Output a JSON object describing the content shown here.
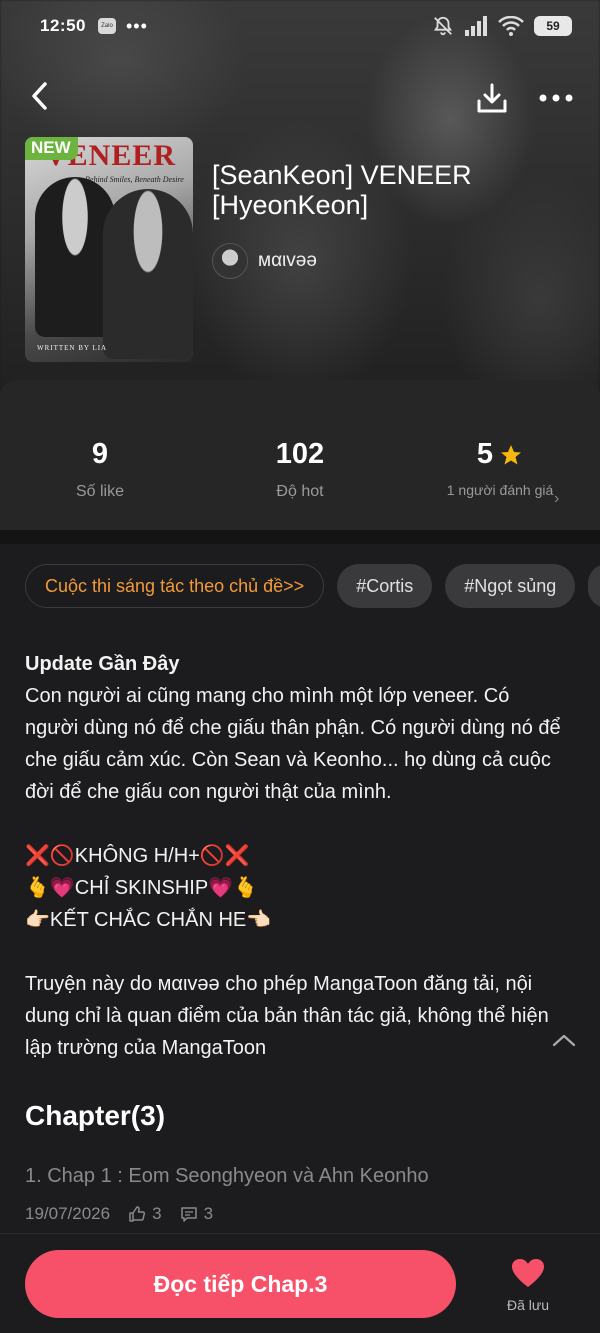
{
  "status_bar": {
    "time": "12:50",
    "zalo_label": "Zalo",
    "dots": "•••",
    "battery": "59"
  },
  "story": {
    "title": "[SeanKeon] VENEER [HyeonKeon]",
    "new_badge": "NEW",
    "cover_title": "VENEER",
    "cover_subtitle": "Behind Smiles, Beneath Desire",
    "cover_credit": "WRITTEN BY LIA",
    "author": "мαιvәә"
  },
  "stats": {
    "likes_value": "9",
    "likes_label": "Số like",
    "hot_value": "102",
    "hot_label": "Độ hot",
    "rating_value": "5",
    "rating_label": "1 người đánh giá"
  },
  "tags": [
    "Cuộc thi sáng tác theo chủ đề>>",
    "#Cortis",
    "#Ngọt sủng"
  ],
  "description": {
    "heading": "Update Gần Đây",
    "body": "Con người ai cũng mang cho mình một lớp veneer. Có người dùng nó để che giấu thân phận. Có người dùng nó để che giấu cảm xúc. Còn Sean và Keonho... họ dùng cả cuộc đời để che giấu con người thật của mình.",
    "line1": "❌🚫KHÔNG H/H+🚫❌",
    "line2": "🫰💗CHỈ SKINSHIP💗🫰",
    "line3": "👉🏻KẾT CHẮC CHẮN HE👈🏻",
    "disclaimer": "Truyện này do мαιvәә cho phép MangaToon đăng tải, nội dung chỉ là quan điểm của bản thân tác giả, không thể hiện lập trường của MangaToon"
  },
  "chapters": {
    "header": "Chapter(3)",
    "items": [
      {
        "title": "1. Chap 1 : Eom Seonghyeon và Ahn Keonho",
        "date": "19/07/2026",
        "likes": "3",
        "comments": "3"
      }
    ]
  },
  "bottom": {
    "read_label": "Đọc tiếp Chap.3",
    "saved_label": "Đã lưu"
  },
  "colors": {
    "accent": "#f7516a",
    "contest": "#f29a3a",
    "star": "#f5b90e",
    "new_badge": "#6db33f"
  }
}
